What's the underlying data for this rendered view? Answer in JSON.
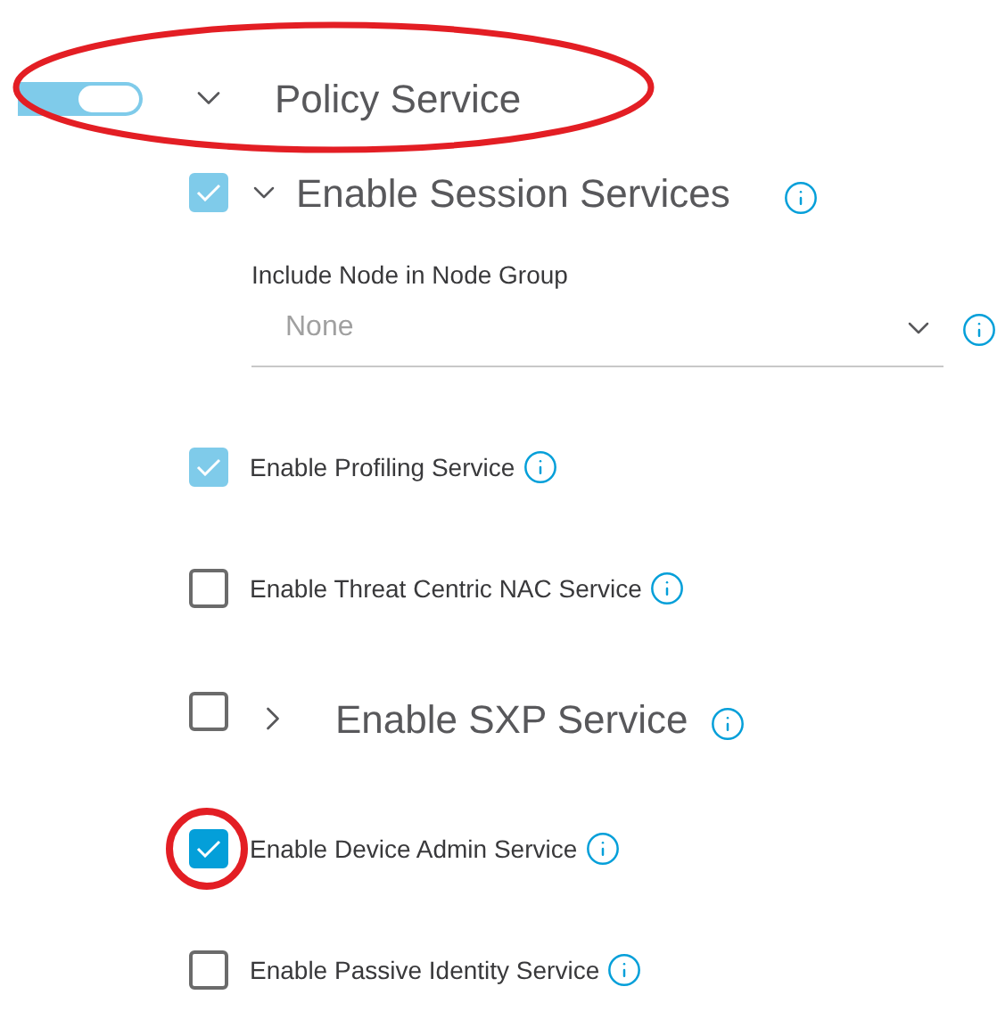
{
  "policy_service": {
    "title": "Policy Service",
    "on": true,
    "expanded": true,
    "circled": true
  },
  "session_services": {
    "label": "Enable Session Services",
    "checked": true,
    "disabled": true,
    "expanded": true
  },
  "node_group": {
    "label": "Include Node in Node Group",
    "value": "None"
  },
  "options": [
    {
      "kind": "option",
      "label": "Enable Profiling Service",
      "checked": true,
      "disabled": true,
      "circled": false
    },
    {
      "kind": "option",
      "label": "Enable Threat Centric NAC Service",
      "checked": false,
      "disabled": false,
      "circled": false
    },
    {
      "kind": "section",
      "label": "Enable SXP Service",
      "checked": false,
      "disabled": false,
      "expanded": false,
      "circled": false
    },
    {
      "kind": "option",
      "label": "Enable Device Admin Service",
      "checked": true,
      "disabled": false,
      "circled": true
    },
    {
      "kind": "option",
      "label": "Enable Passive Identity Service",
      "checked": false,
      "disabled": false,
      "circled": false
    }
  ]
}
